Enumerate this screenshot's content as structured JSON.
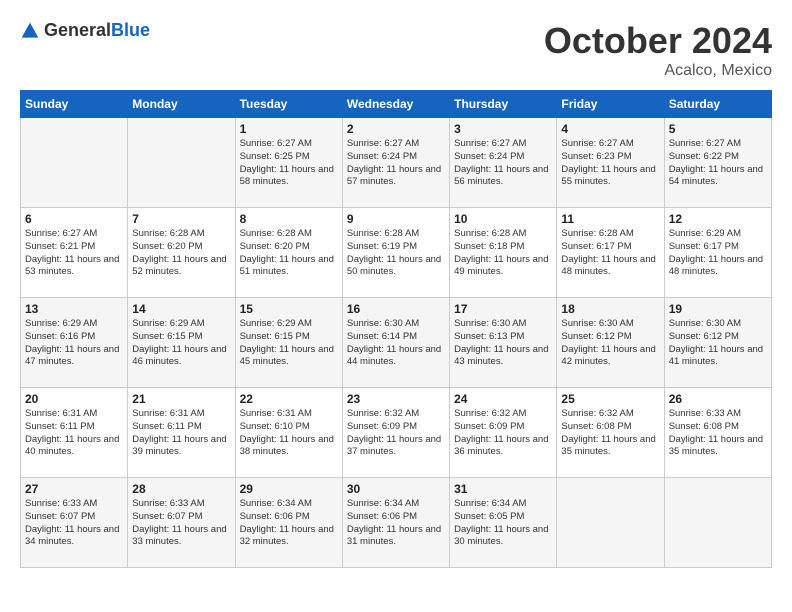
{
  "logo": {
    "general": "General",
    "blue": "Blue"
  },
  "title": "October 2024",
  "location": "Acalco, Mexico",
  "days_of_week": [
    "Sunday",
    "Monday",
    "Tuesday",
    "Wednesday",
    "Thursday",
    "Friday",
    "Saturday"
  ],
  "weeks": [
    [
      {
        "day": "",
        "sunrise": "",
        "sunset": "",
        "daylight": ""
      },
      {
        "day": "",
        "sunrise": "",
        "sunset": "",
        "daylight": ""
      },
      {
        "day": "1",
        "sunrise": "Sunrise: 6:27 AM",
        "sunset": "Sunset: 6:25 PM",
        "daylight": "Daylight: 11 hours and 58 minutes."
      },
      {
        "day": "2",
        "sunrise": "Sunrise: 6:27 AM",
        "sunset": "Sunset: 6:24 PM",
        "daylight": "Daylight: 11 hours and 57 minutes."
      },
      {
        "day": "3",
        "sunrise": "Sunrise: 6:27 AM",
        "sunset": "Sunset: 6:24 PM",
        "daylight": "Daylight: 11 hours and 56 minutes."
      },
      {
        "day": "4",
        "sunrise": "Sunrise: 6:27 AM",
        "sunset": "Sunset: 6:23 PM",
        "daylight": "Daylight: 11 hours and 55 minutes."
      },
      {
        "day": "5",
        "sunrise": "Sunrise: 6:27 AM",
        "sunset": "Sunset: 6:22 PM",
        "daylight": "Daylight: 11 hours and 54 minutes."
      }
    ],
    [
      {
        "day": "6",
        "sunrise": "Sunrise: 6:27 AM",
        "sunset": "Sunset: 6:21 PM",
        "daylight": "Daylight: 11 hours and 53 minutes."
      },
      {
        "day": "7",
        "sunrise": "Sunrise: 6:28 AM",
        "sunset": "Sunset: 6:20 PM",
        "daylight": "Daylight: 11 hours and 52 minutes."
      },
      {
        "day": "8",
        "sunrise": "Sunrise: 6:28 AM",
        "sunset": "Sunset: 6:20 PM",
        "daylight": "Daylight: 11 hours and 51 minutes."
      },
      {
        "day": "9",
        "sunrise": "Sunrise: 6:28 AM",
        "sunset": "Sunset: 6:19 PM",
        "daylight": "Daylight: 11 hours and 50 minutes."
      },
      {
        "day": "10",
        "sunrise": "Sunrise: 6:28 AM",
        "sunset": "Sunset: 6:18 PM",
        "daylight": "Daylight: 11 hours and 49 minutes."
      },
      {
        "day": "11",
        "sunrise": "Sunrise: 6:28 AM",
        "sunset": "Sunset: 6:17 PM",
        "daylight": "Daylight: 11 hours and 48 minutes."
      },
      {
        "day": "12",
        "sunrise": "Sunrise: 6:29 AM",
        "sunset": "Sunset: 6:17 PM",
        "daylight": "Daylight: 11 hours and 48 minutes."
      }
    ],
    [
      {
        "day": "13",
        "sunrise": "Sunrise: 6:29 AM",
        "sunset": "Sunset: 6:16 PM",
        "daylight": "Daylight: 11 hours and 47 minutes."
      },
      {
        "day": "14",
        "sunrise": "Sunrise: 6:29 AM",
        "sunset": "Sunset: 6:15 PM",
        "daylight": "Daylight: 11 hours and 46 minutes."
      },
      {
        "day": "15",
        "sunrise": "Sunrise: 6:29 AM",
        "sunset": "Sunset: 6:15 PM",
        "daylight": "Daylight: 11 hours and 45 minutes."
      },
      {
        "day": "16",
        "sunrise": "Sunrise: 6:30 AM",
        "sunset": "Sunset: 6:14 PM",
        "daylight": "Daylight: 11 hours and 44 minutes."
      },
      {
        "day": "17",
        "sunrise": "Sunrise: 6:30 AM",
        "sunset": "Sunset: 6:13 PM",
        "daylight": "Daylight: 11 hours and 43 minutes."
      },
      {
        "day": "18",
        "sunrise": "Sunrise: 6:30 AM",
        "sunset": "Sunset: 6:12 PM",
        "daylight": "Daylight: 11 hours and 42 minutes."
      },
      {
        "day": "19",
        "sunrise": "Sunrise: 6:30 AM",
        "sunset": "Sunset: 6:12 PM",
        "daylight": "Daylight: 11 hours and 41 minutes."
      }
    ],
    [
      {
        "day": "20",
        "sunrise": "Sunrise: 6:31 AM",
        "sunset": "Sunset: 6:11 PM",
        "daylight": "Daylight: 11 hours and 40 minutes."
      },
      {
        "day": "21",
        "sunrise": "Sunrise: 6:31 AM",
        "sunset": "Sunset: 6:11 PM",
        "daylight": "Daylight: 11 hours and 39 minutes."
      },
      {
        "day": "22",
        "sunrise": "Sunrise: 6:31 AM",
        "sunset": "Sunset: 6:10 PM",
        "daylight": "Daylight: 11 hours and 38 minutes."
      },
      {
        "day": "23",
        "sunrise": "Sunrise: 6:32 AM",
        "sunset": "Sunset: 6:09 PM",
        "daylight": "Daylight: 11 hours and 37 minutes."
      },
      {
        "day": "24",
        "sunrise": "Sunrise: 6:32 AM",
        "sunset": "Sunset: 6:09 PM",
        "daylight": "Daylight: 11 hours and 36 minutes."
      },
      {
        "day": "25",
        "sunrise": "Sunrise: 6:32 AM",
        "sunset": "Sunset: 6:08 PM",
        "daylight": "Daylight: 11 hours and 35 minutes."
      },
      {
        "day": "26",
        "sunrise": "Sunrise: 6:33 AM",
        "sunset": "Sunset: 6:08 PM",
        "daylight": "Daylight: 11 hours and 35 minutes."
      }
    ],
    [
      {
        "day": "27",
        "sunrise": "Sunrise: 6:33 AM",
        "sunset": "Sunset: 6:07 PM",
        "daylight": "Daylight: 11 hours and 34 minutes."
      },
      {
        "day": "28",
        "sunrise": "Sunrise: 6:33 AM",
        "sunset": "Sunset: 6:07 PM",
        "daylight": "Daylight: 11 hours and 33 minutes."
      },
      {
        "day": "29",
        "sunrise": "Sunrise: 6:34 AM",
        "sunset": "Sunset: 6:06 PM",
        "daylight": "Daylight: 11 hours and 32 minutes."
      },
      {
        "day": "30",
        "sunrise": "Sunrise: 6:34 AM",
        "sunset": "Sunset: 6:06 PM",
        "daylight": "Daylight: 11 hours and 31 minutes."
      },
      {
        "day": "31",
        "sunrise": "Sunrise: 6:34 AM",
        "sunset": "Sunset: 6:05 PM",
        "daylight": "Daylight: 11 hours and 30 minutes."
      },
      {
        "day": "",
        "sunrise": "",
        "sunset": "",
        "daylight": ""
      },
      {
        "day": "",
        "sunrise": "",
        "sunset": "",
        "daylight": ""
      }
    ]
  ]
}
